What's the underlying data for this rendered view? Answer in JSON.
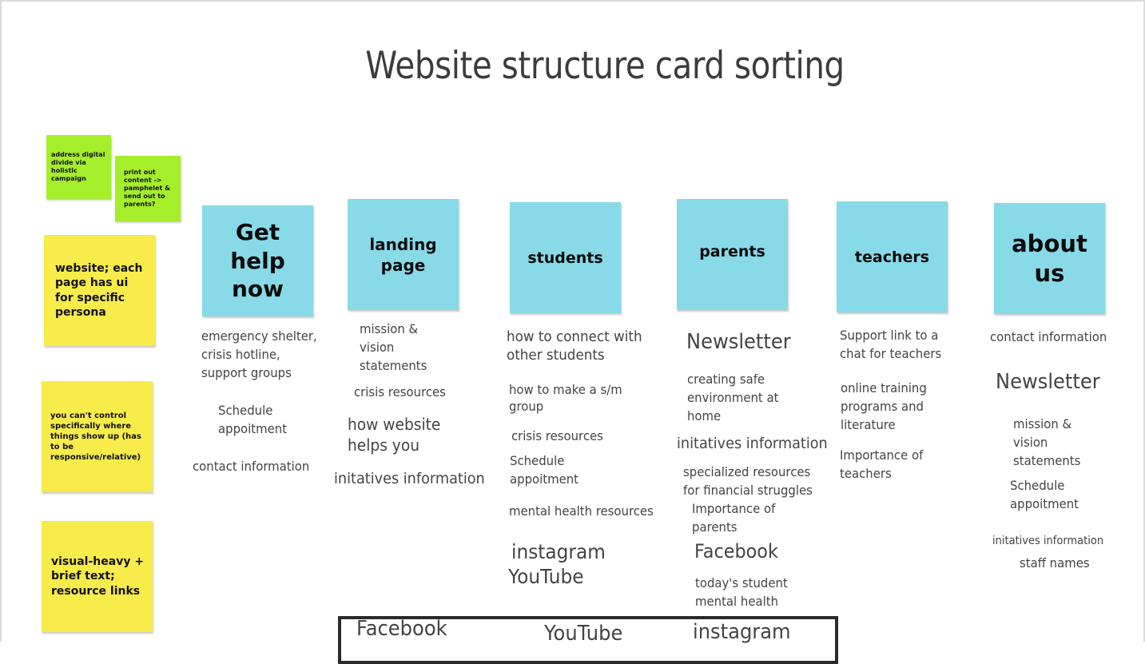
{
  "title": "Website structure card sorting",
  "colors": {
    "green_note": "#a5ee2a",
    "yellow_note": "#f7ec4a",
    "category_note": "#88dae8",
    "card_text": "#444444",
    "title_text": "#3c3c3c"
  },
  "notes": {
    "green": [
      "address digital divide via holistic campaign",
      "print out content -> pamphelet & send out to parents?"
    ],
    "yellow": [
      "website; each page has ui for specific persona",
      "you can't control specifically where things show up (has to be responsive/relative)",
      "visual-heavy + brief text; resource links"
    ]
  },
  "categories": [
    {
      "label": "Get help now",
      "cards": [
        "emergency shelter,\ncrisis hotline,\n support groups",
        "Schedule\nappoitment",
        "contact information"
      ]
    },
    {
      "label": "landing page",
      "cards": [
        "mission &\nvision\nstatements",
        "crisis resources",
        "how website\nhelps you",
        "initatives information"
      ]
    },
    {
      "label": "students",
      "cards": [
        "how to connect with\nother students",
        "how to make a s/m\ngroup",
        "crisis resources",
        "Schedule\nappoitment",
        "mental health resources",
        "instagram",
        "YouTube"
      ]
    },
    {
      "label": "parents",
      "cards": [
        "Newsletter",
        "creating safe\nenvironment at\nhome",
        "initatives information",
        "specialized resources\nfor financial struggles",
        "Importance of\nparents",
        "Facebook",
        "today's student\nmental health"
      ]
    },
    {
      "label": "teachers",
      "cards": [
        "Support link to a\nchat for teachers",
        "online training\nprograms and\nliterature",
        "Importance of\nteachers"
      ]
    },
    {
      "label": "about us",
      "cards": [
        "contact information",
        "Newsletter",
        "mission &\nvision\nstatements",
        "Schedule\nappoitment",
        "initatives information",
        "staff names"
      ]
    }
  ],
  "bottom_group": {
    "cards": [
      "Facebook",
      "YouTube",
      "instagram"
    ]
  }
}
